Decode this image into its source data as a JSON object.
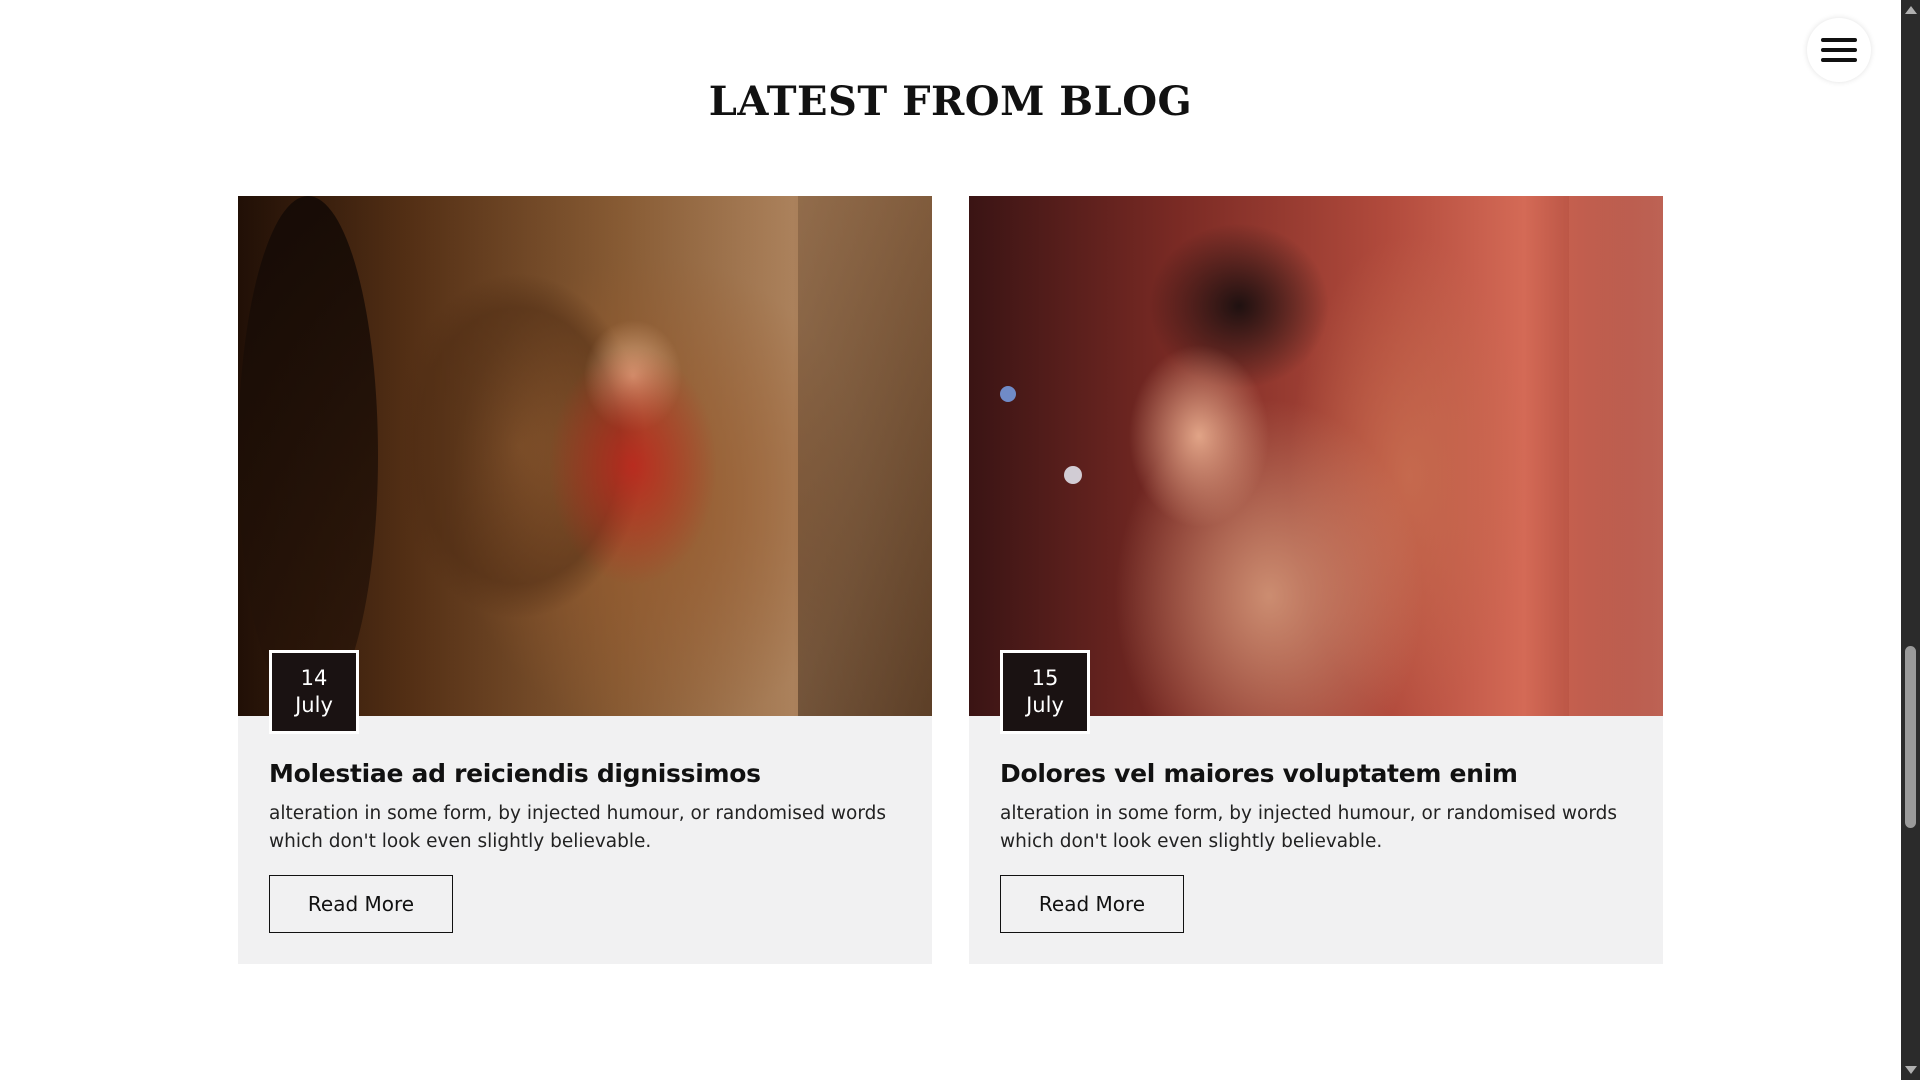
{
  "section": {
    "title": "LATEST FROM BLOG"
  },
  "menu": {
    "icon": "hamburger-icon"
  },
  "posts": [
    {
      "day": "14",
      "month": "July",
      "title": "Molestiae ad reiciendis dignissimos",
      "excerpt": "alteration in some form, by injected humour, or randomised words which don't look even slightly believable.",
      "button_label": "Read More"
    },
    {
      "day": "15",
      "month": "July",
      "title": "Dolores vel maiores voluptatem enim",
      "excerpt": "alteration in some form, by injected humour, or randomised words which don't look even slightly believable.",
      "button_label": "Read More"
    }
  ],
  "colors": {
    "badge_background": "#1a1212",
    "card_background": "#f1f1f2",
    "text": "#111111"
  }
}
